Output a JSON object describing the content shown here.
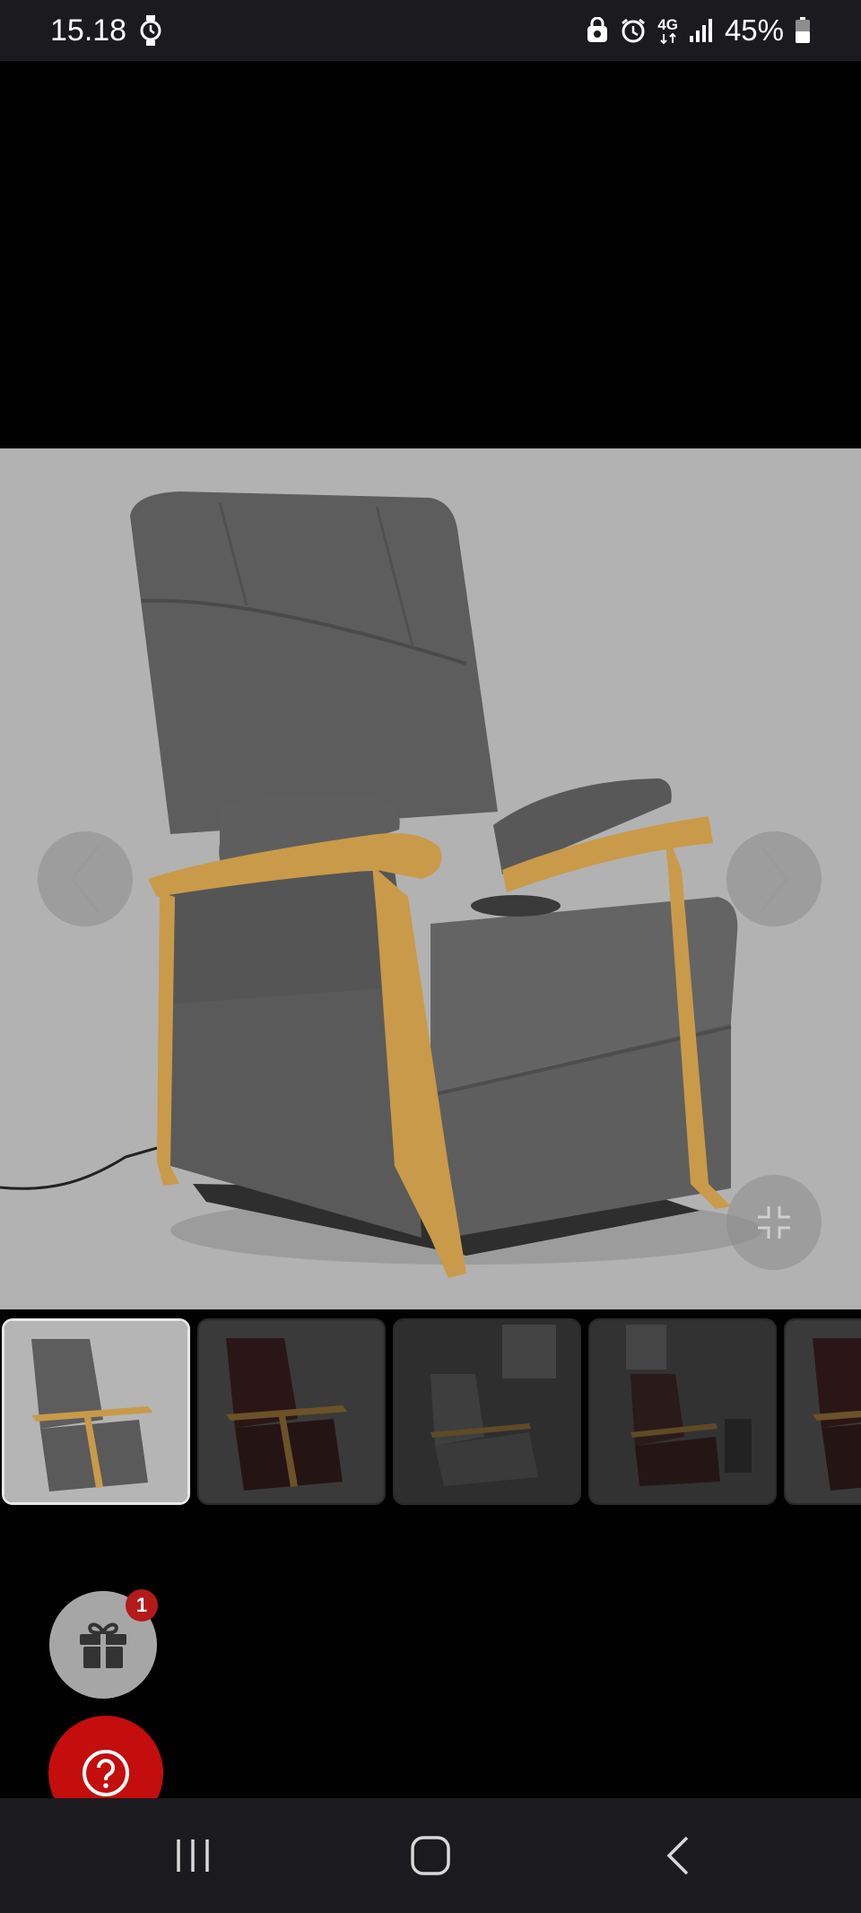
{
  "status_bar": {
    "time": "15.18",
    "network": "4G",
    "battery": "45%",
    "icons": [
      "watch-icon",
      "recycle-lock-icon",
      "alarm-icon",
      "network-4g-icon",
      "signal-icon",
      "battery-icon"
    ]
  },
  "gallery": {
    "thumbnail_count_visible": 5,
    "active_index": 0,
    "thumbnails": [
      {
        "variant": "grey-chair-studio"
      },
      {
        "variant": "brown-chair-studio"
      },
      {
        "variant": "grey-chair-room-reclined"
      },
      {
        "variant": "brown-chair-room"
      },
      {
        "variant": "brown-chair-partial"
      }
    ],
    "controls": [
      "chevron-left-icon",
      "chevron-right-icon",
      "collapse-icon"
    ]
  },
  "floating": {
    "gift_badge_count": "1",
    "gift_icon": "gift-icon",
    "help_icon": "help-icon"
  },
  "colors": {
    "accent_red": "#c40d0d",
    "badge_red": "#b31a1a",
    "image_bg": "#b2b2b2",
    "chair_fabric": "#5c5c5c",
    "chair_wood": "#c99a4a"
  },
  "nav_bar": {
    "icons": [
      "recents-icon",
      "home-icon",
      "back-icon"
    ]
  }
}
